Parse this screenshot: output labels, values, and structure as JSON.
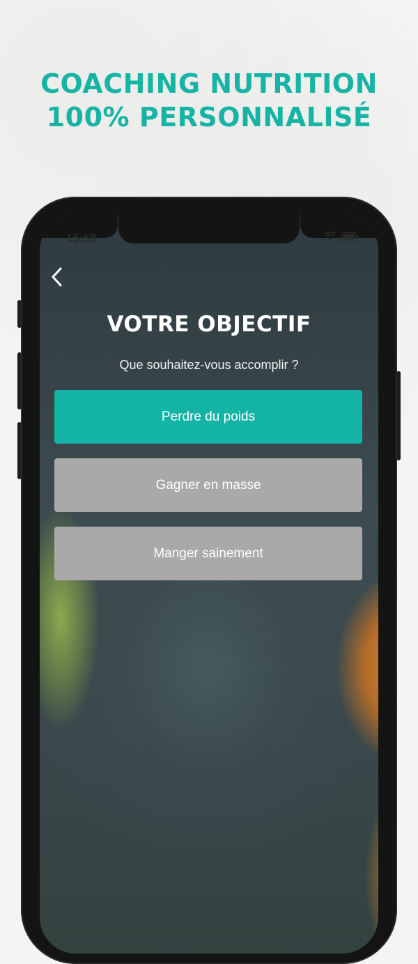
{
  "headline": {
    "line1": "COACHING NUTRITION",
    "line2": "100% PERSONNALISÉ"
  },
  "status_bar": {
    "time": "15:59"
  },
  "screen": {
    "title": "VOTRE OBJECTIF",
    "subtitle": "Que souhaitez-vous accomplir ?",
    "options": [
      {
        "label": "Perdre du poids",
        "selected": true
      },
      {
        "label": "Gagner en masse",
        "selected": false
      },
      {
        "label": "Manger sainement",
        "selected": false
      }
    ]
  },
  "icons": {
    "back": "chevron-left-icon",
    "wifi": "wifi-icon",
    "battery": "battery-icon"
  },
  "colors": {
    "accent": "#13b3a5",
    "option_inactive": "#a9a9a9",
    "headline": "#17b4a5"
  }
}
